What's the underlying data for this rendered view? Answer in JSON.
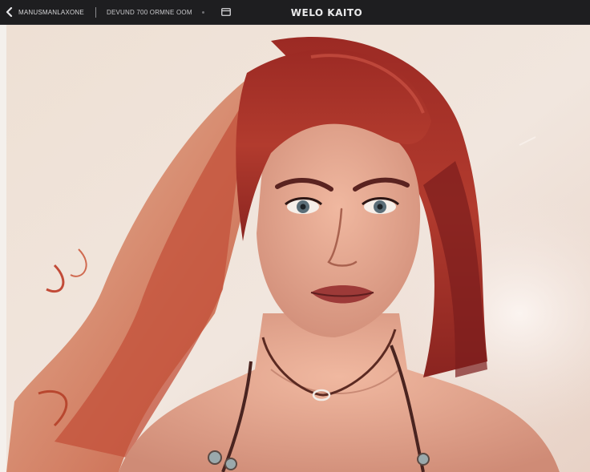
{
  "toolbar": {
    "breadcrumb_primary": "MANUSMANLAXONE",
    "breadcrumb_secondary": "DEVUND 700 ORMNE OOM",
    "title": "WELO KAITO"
  },
  "icons": {
    "back": "chevron-left-icon",
    "panel": "panel-toggle-icon"
  },
  "colors": {
    "toolbar_bg": "#1e1e20",
    "canvas_bg": "#efe3d9",
    "hair": "#a8342c",
    "skin": "#e7a992"
  }
}
